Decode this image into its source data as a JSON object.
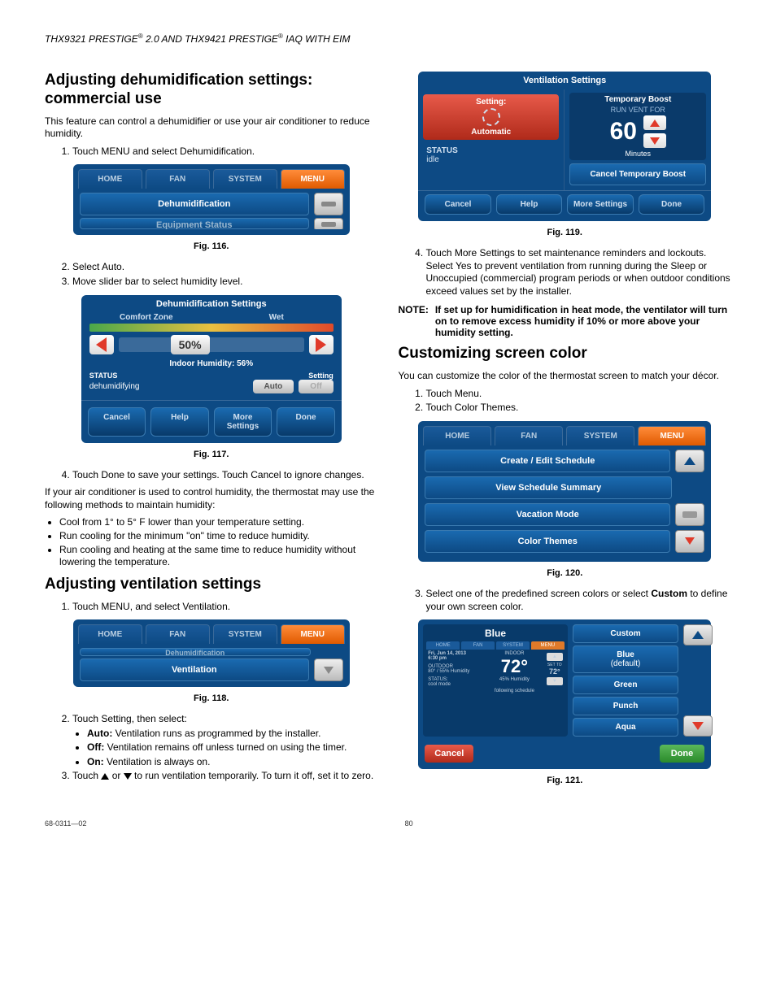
{
  "header": {
    "text": "THX9321 PRESTIGE® 2.0 AND THX9421 PRESTIGE® IAQ WITH EIM"
  },
  "left": {
    "h1": "Adjusting dehumidification settings: commercial use",
    "p1": "This feature can control a dehumidifier or use your air conditioner to reduce humidity.",
    "step1": "Touch MENU and select Dehumidification.",
    "fig116": {
      "tabs": {
        "home": "HOME",
        "fan": "FAN",
        "system": "SYSTEM",
        "menu": "MENU"
      },
      "item1": "Dehumidification",
      "item2": "Equipment Status",
      "cap": "Fig. 116."
    },
    "step2": "Select Auto.",
    "step3": "Move slider bar to select humidity level.",
    "fig117": {
      "title": "Dehumidification Settings",
      "left_label": "Comfort Zone",
      "right_label": "Wet",
      "value": "50%",
      "indoor": "Indoor Humidity: 56%",
      "status_lbl": "STATUS",
      "status_val": "dehumidifying",
      "setting_lbl": "Setting",
      "auto": "Auto",
      "off": "Off",
      "cancel": "Cancel",
      "help": "Help",
      "more": "More Settings",
      "done": "Done",
      "cap": "Fig. 117."
    },
    "step4": "Touch Done to save your settings. Touch Cancel to ignore changes.",
    "p2": "If your air conditioner is used to control humidity, the thermostat may use the following methods to maintain humidity:",
    "b1": "Cool from 1° to 5° F lower than your temperature setting.",
    "b2": "Run cooling for the minimum \"on\" time to reduce humidity.",
    "b3": "Run cooling and heating at the same time to reduce humidity without lowering the temperature.",
    "h2": "Adjusting ventilation settings",
    "v_step1": "Touch MENU, and select Ventilation.",
    "fig118": {
      "tabs": {
        "home": "HOME",
        "fan": "FAN",
        "system": "SYSTEM",
        "menu": "MENU"
      },
      "item_top": "Dehumidification",
      "item_mid": "Ventilation",
      "cap": "Fig. 118."
    },
    "v_step2": "Touch Setting, then select:",
    "v_sub_auto_b": "Auto:",
    "v_sub_auto": " Ventilation runs as programmed by the installer.",
    "v_sub_off_b": "Off:",
    "v_sub_off": " Ventilation remains off unless turned on using the timer.",
    "v_sub_on_b": "On:",
    "v_sub_on": " Ventilation is always on.",
    "v_step3a": "Touch ",
    "v_step3b": " or ",
    "v_step3c": " to run ventilation temporarily. To turn it off, set it to zero."
  },
  "right": {
    "fig119": {
      "title": "Ventilation Settings",
      "setting": "Setting:",
      "auto": "Automatic",
      "tboost": "Temporary Boost",
      "run_for": "RUN VENT FOR",
      "num": "60",
      "minutes": "Minutes",
      "status_lbl": "STATUS",
      "status_val": "idle",
      "cancel_boost": "Cancel Temporary Boost",
      "cancel": "Cancel",
      "help": "Help",
      "more": "More Settings",
      "done": "Done",
      "cap": "Fig. 119."
    },
    "step4": "Touch More Settings to set maintenance reminders and lockouts. Select Yes to prevent ventilation from running during the Sleep or Unoccupied (commercial) program periods or when outdoor conditions exceed values set by the installer.",
    "note_label": "NOTE:",
    "note_body": "If set up for humidification in heat mode, the ventilator will turn on to remove excess humidity if 10% or more above your humidity setting.",
    "h1": "Customizing screen color",
    "p1": "You can customize the color of the thermostat screen to match your décor.",
    "c_step1": "Touch Menu.",
    "c_step2": "Touch Color Themes.",
    "fig120": {
      "tabs": {
        "home": "HOME",
        "fan": "FAN",
        "system": "SYSTEM",
        "menu": "MENU"
      },
      "i1": "Create / Edit Schedule",
      "i2": "View Schedule Summary",
      "i3": "Vacation Mode",
      "i4": "Color Themes",
      "cap": "Fig. 120."
    },
    "c_step3a": "Select one of the predefined screen colors or select ",
    "c_step3b": "Custom",
    "c_step3c": " to define your own screen color.",
    "fig121": {
      "title": "Blue",
      "preview": {
        "t1": "HOME",
        "t2": "FAN",
        "t3": "SYSTEM",
        "t4": "MENU",
        "date": "Fri, Jun 14, 2013",
        "time": "6:30 pm",
        "indoor": "INDOOR",
        "temp": "72°",
        "setto": "SET TO",
        "setto_val": "72°",
        "outdoor": "OUTDOOR",
        "outdoor_val": "80° / 55% Humidity",
        "indoor_hum": "45% Humidity",
        "status": "STATUS:",
        "status_val": "cool mode",
        "follow": "following schedule"
      },
      "items": {
        "custom": "Custom",
        "blue1": "Blue",
        "blue2": "(default)",
        "green": "Green",
        "punch": "Punch",
        "aqua": "Aqua"
      },
      "cancel": "Cancel",
      "done": "Done",
      "cap": "Fig. 121."
    }
  },
  "footer": {
    "left": "68-0311—02",
    "page": "80"
  }
}
